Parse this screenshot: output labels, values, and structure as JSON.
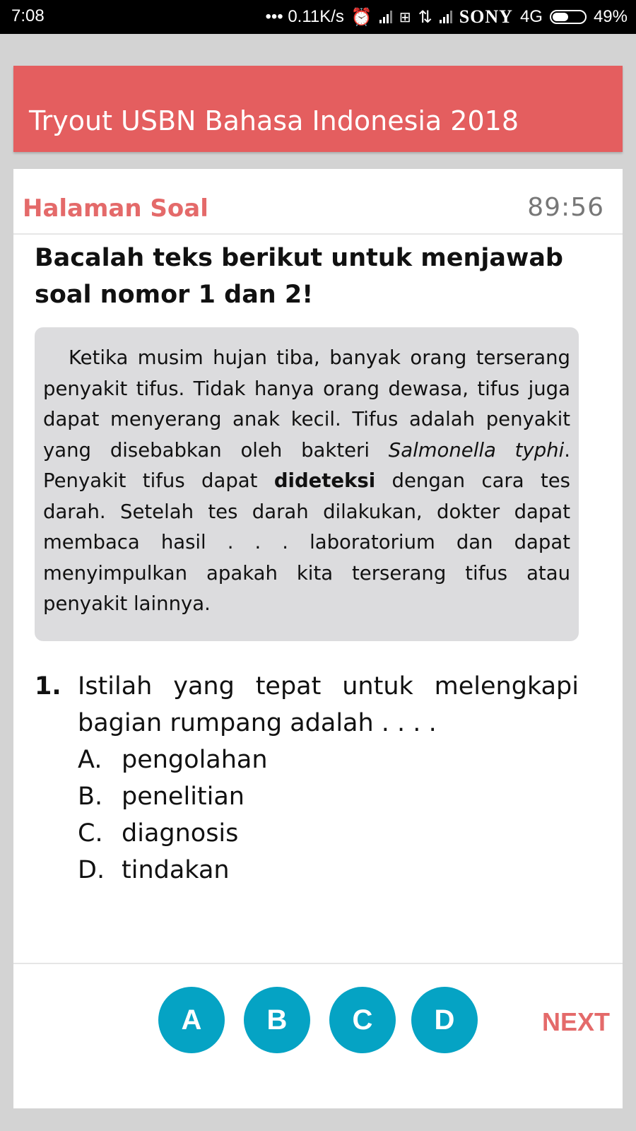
{
  "status_bar": {
    "time": "7:08",
    "net_speed": "••• 0.11K/s",
    "carrier": "SONY",
    "network": "4G",
    "battery": "49%"
  },
  "app_bar": {
    "title": "Tryout USBN Bahasa Indonesia 2018"
  },
  "header": {
    "section_title": "Halaman Soal",
    "timer": "89:56"
  },
  "instruction": "Bacalah teks berikut untuk menjawab soal nomor 1 dan 2!",
  "passage": {
    "part1": "Ketika musim hujan tiba, banyak orang terserang penyakit tifus. Tidak hanya orang dewasa, tifus juga dapat menyerang anak kecil. Tifus adalah penyakit yang disebabkan oleh bakteri ",
    "italic": "Salmonella typhi",
    "part2": ". Penyakit tifus dapat ",
    "bold": "dideteksi",
    "part3": " dengan cara tes darah. Setelah tes darah dilakukan, dokter dapat membaca hasil . . . laboratorium dan dapat menyimpulkan apakah kita terserang tifus atau penyakit lainnya."
  },
  "question": {
    "number": "1.",
    "text": "Istilah yang tepat untuk melengkapi bagian rumpang adalah . . . .",
    "options": [
      {
        "letter": "A.",
        "text": "pengolahan"
      },
      {
        "letter": "B.",
        "text": "penelitian"
      },
      {
        "letter": "C.",
        "text": "diagnosis"
      },
      {
        "letter": "D.",
        "text": "tindakan"
      }
    ]
  },
  "answer_buttons": [
    "A",
    "B",
    "C",
    "D"
  ],
  "next_label": "NEXT",
  "colors": {
    "accent": "#e45e5f",
    "answer_button": "#05a3c4",
    "passage_bg": "#dcdcde"
  }
}
